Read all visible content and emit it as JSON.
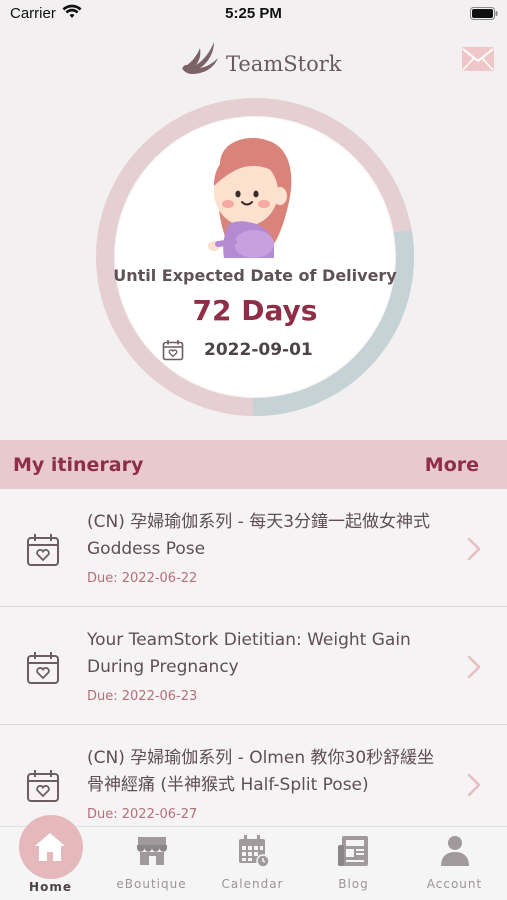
{
  "status_bar": {
    "carrier": "Carrier",
    "time": "5:25 PM"
  },
  "header": {
    "app_name": "TeamStork"
  },
  "countdown": {
    "label": "Until Expected Date of Delivery",
    "days": "72 Days",
    "due_date": "2022-09-01",
    "progress_fraction": 0.72
  },
  "itinerary": {
    "title": "My itinerary",
    "more_label": "More",
    "items": [
      {
        "title": "(CN) 孕婦瑜伽系列 - 每天3分鐘一起做女神式 Goddess Pose",
        "due": "Due: 2022-06-22"
      },
      {
        "title": "Your TeamStork Dietitian: Weight Gain During Pregnancy",
        "due": "Due: 2022-06-23"
      },
      {
        "title": "(CN) 孕婦瑜伽系列 - Olmen 教你30秒舒緩坐骨神經痛 (半神猴式 Half-Split Pose)",
        "due": "Due: 2022-06-27"
      }
    ]
  },
  "tabs": [
    {
      "label": "Home",
      "icon": "home-icon"
    },
    {
      "label": "eBoutique",
      "icon": "store-icon"
    },
    {
      "label": "Calendar",
      "icon": "calendar-icon"
    },
    {
      "label": "Blog",
      "icon": "newspaper-icon"
    },
    {
      "label": "Account",
      "icon": "person-icon"
    }
  ],
  "colors": {
    "accent": "#8e2f47",
    "header_band": "#e8c9cc",
    "ring_pink": "#e6cfd2",
    "ring_blue": "#c5d3d6"
  }
}
